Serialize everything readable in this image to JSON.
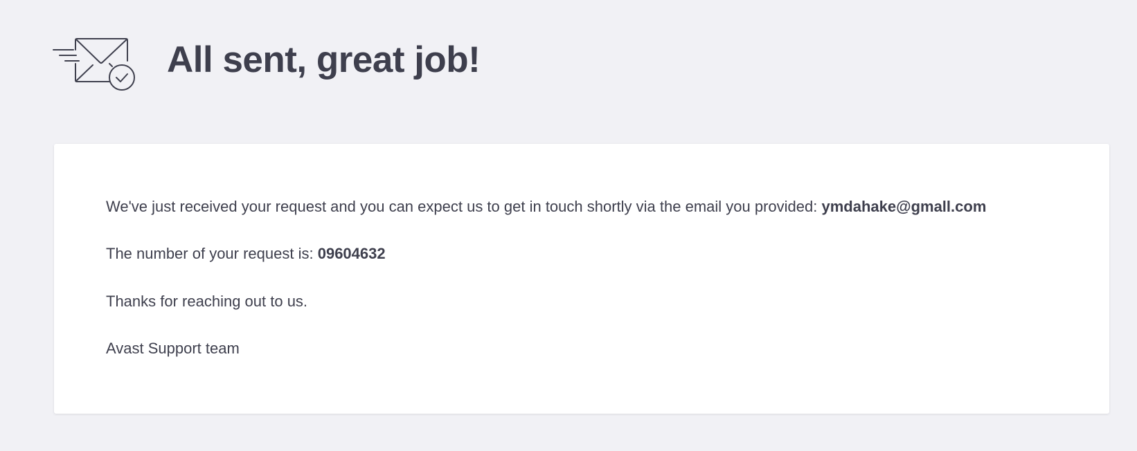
{
  "header": {
    "title": "All sent, great job!",
    "icon": "envelope-sent-check-icon"
  },
  "message": {
    "received_text": "We've just received your request and you can expect us to get in touch shortly via the email you provided:",
    "email": "ymdahake@gmall.com",
    "request_number_label": "The number of your request is:",
    "request_number": "09604632",
    "thanks": "Thanks for reaching out to us.",
    "signature": "Avast Support team"
  },
  "colors": {
    "background": "#f1f1f5",
    "card": "#ffffff",
    "text": "#3e3f4d"
  }
}
